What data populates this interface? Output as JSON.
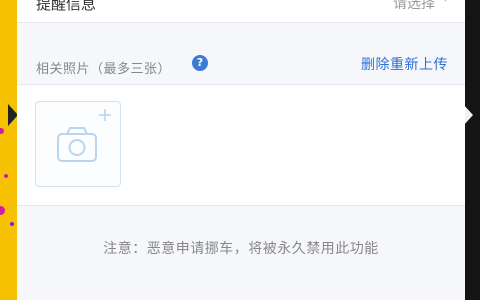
{
  "reminder_row": {
    "label": "提醒信息",
    "value": "请选择"
  },
  "photos": {
    "title": "相关照片（最多三张）",
    "help_icon_glyph": "?",
    "reupload_label": "删除重新上传",
    "upload_icon": "camera-add-icon"
  },
  "notice": {
    "text": "注意：恶意申请挪车，将被永久禁用此功能"
  },
  "colors": {
    "accent": "#2f6fd6",
    "left_bg": "#f6c100",
    "panel_bg": "#f5f7fa"
  }
}
